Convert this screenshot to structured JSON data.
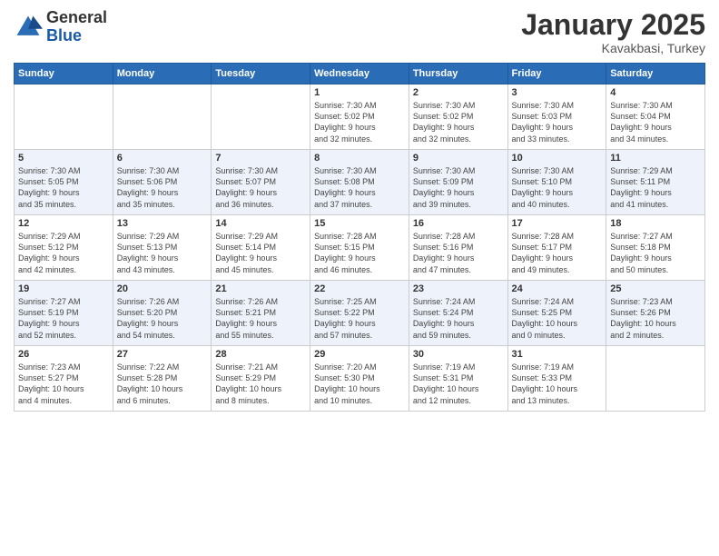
{
  "logo": {
    "general": "General",
    "blue": "Blue"
  },
  "title": "January 2025",
  "location": "Kavakbasi, Turkey",
  "weekdays": [
    "Sunday",
    "Monday",
    "Tuesday",
    "Wednesday",
    "Thursday",
    "Friday",
    "Saturday"
  ],
  "weeks": [
    [
      {
        "day": "",
        "info": ""
      },
      {
        "day": "",
        "info": ""
      },
      {
        "day": "",
        "info": ""
      },
      {
        "day": "1",
        "info": "Sunrise: 7:30 AM\nSunset: 5:02 PM\nDaylight: 9 hours\nand 32 minutes."
      },
      {
        "day": "2",
        "info": "Sunrise: 7:30 AM\nSunset: 5:02 PM\nDaylight: 9 hours\nand 32 minutes."
      },
      {
        "day": "3",
        "info": "Sunrise: 7:30 AM\nSunset: 5:03 PM\nDaylight: 9 hours\nand 33 minutes."
      },
      {
        "day": "4",
        "info": "Sunrise: 7:30 AM\nSunset: 5:04 PM\nDaylight: 9 hours\nand 34 minutes."
      }
    ],
    [
      {
        "day": "5",
        "info": "Sunrise: 7:30 AM\nSunset: 5:05 PM\nDaylight: 9 hours\nand 35 minutes."
      },
      {
        "day": "6",
        "info": "Sunrise: 7:30 AM\nSunset: 5:06 PM\nDaylight: 9 hours\nand 35 minutes."
      },
      {
        "day": "7",
        "info": "Sunrise: 7:30 AM\nSunset: 5:07 PM\nDaylight: 9 hours\nand 36 minutes."
      },
      {
        "day": "8",
        "info": "Sunrise: 7:30 AM\nSunset: 5:08 PM\nDaylight: 9 hours\nand 37 minutes."
      },
      {
        "day": "9",
        "info": "Sunrise: 7:30 AM\nSunset: 5:09 PM\nDaylight: 9 hours\nand 39 minutes."
      },
      {
        "day": "10",
        "info": "Sunrise: 7:30 AM\nSunset: 5:10 PM\nDaylight: 9 hours\nand 40 minutes."
      },
      {
        "day": "11",
        "info": "Sunrise: 7:29 AM\nSunset: 5:11 PM\nDaylight: 9 hours\nand 41 minutes."
      }
    ],
    [
      {
        "day": "12",
        "info": "Sunrise: 7:29 AM\nSunset: 5:12 PM\nDaylight: 9 hours\nand 42 minutes."
      },
      {
        "day": "13",
        "info": "Sunrise: 7:29 AM\nSunset: 5:13 PM\nDaylight: 9 hours\nand 43 minutes."
      },
      {
        "day": "14",
        "info": "Sunrise: 7:29 AM\nSunset: 5:14 PM\nDaylight: 9 hours\nand 45 minutes."
      },
      {
        "day": "15",
        "info": "Sunrise: 7:28 AM\nSunset: 5:15 PM\nDaylight: 9 hours\nand 46 minutes."
      },
      {
        "day": "16",
        "info": "Sunrise: 7:28 AM\nSunset: 5:16 PM\nDaylight: 9 hours\nand 47 minutes."
      },
      {
        "day": "17",
        "info": "Sunrise: 7:28 AM\nSunset: 5:17 PM\nDaylight: 9 hours\nand 49 minutes."
      },
      {
        "day": "18",
        "info": "Sunrise: 7:27 AM\nSunset: 5:18 PM\nDaylight: 9 hours\nand 50 minutes."
      }
    ],
    [
      {
        "day": "19",
        "info": "Sunrise: 7:27 AM\nSunset: 5:19 PM\nDaylight: 9 hours\nand 52 minutes."
      },
      {
        "day": "20",
        "info": "Sunrise: 7:26 AM\nSunset: 5:20 PM\nDaylight: 9 hours\nand 54 minutes."
      },
      {
        "day": "21",
        "info": "Sunrise: 7:26 AM\nSunset: 5:21 PM\nDaylight: 9 hours\nand 55 minutes."
      },
      {
        "day": "22",
        "info": "Sunrise: 7:25 AM\nSunset: 5:22 PM\nDaylight: 9 hours\nand 57 minutes."
      },
      {
        "day": "23",
        "info": "Sunrise: 7:24 AM\nSunset: 5:24 PM\nDaylight: 9 hours\nand 59 minutes."
      },
      {
        "day": "24",
        "info": "Sunrise: 7:24 AM\nSunset: 5:25 PM\nDaylight: 10 hours\nand 0 minutes."
      },
      {
        "day": "25",
        "info": "Sunrise: 7:23 AM\nSunset: 5:26 PM\nDaylight: 10 hours\nand 2 minutes."
      }
    ],
    [
      {
        "day": "26",
        "info": "Sunrise: 7:23 AM\nSunset: 5:27 PM\nDaylight: 10 hours\nand 4 minutes."
      },
      {
        "day": "27",
        "info": "Sunrise: 7:22 AM\nSunset: 5:28 PM\nDaylight: 10 hours\nand 6 minutes."
      },
      {
        "day": "28",
        "info": "Sunrise: 7:21 AM\nSunset: 5:29 PM\nDaylight: 10 hours\nand 8 minutes."
      },
      {
        "day": "29",
        "info": "Sunrise: 7:20 AM\nSunset: 5:30 PM\nDaylight: 10 hours\nand 10 minutes."
      },
      {
        "day": "30",
        "info": "Sunrise: 7:19 AM\nSunset: 5:31 PM\nDaylight: 10 hours\nand 12 minutes."
      },
      {
        "day": "31",
        "info": "Sunrise: 7:19 AM\nSunset: 5:33 PM\nDaylight: 10 hours\nand 13 minutes."
      },
      {
        "day": "",
        "info": ""
      }
    ]
  ]
}
